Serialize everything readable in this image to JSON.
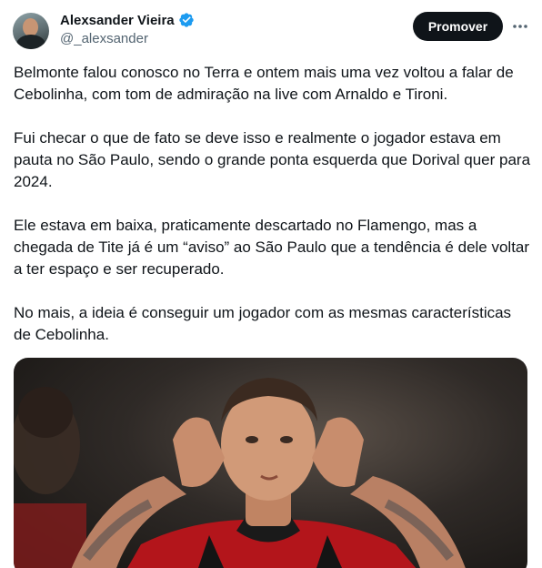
{
  "author": {
    "display_name": "Alexsander Vieira",
    "handle": "@_alexsander",
    "verified_icon": "verified-badge-icon",
    "verified_color": "#1d9bf0"
  },
  "actions": {
    "promote_label": "Promover",
    "more_icon": "more-options-icon"
  },
  "tweet": {
    "paragraphs": [
      "Belmonte falou conosco no Terra e ontem mais uma vez voltou a falar de Cebolinha, com tom de admiração na live com Arnaldo e Tironi.",
      "Fui checar o que de fato se deve isso e realmente o jogador estava em pauta no São Paulo, sendo o grande ponta esquerda que Dorival quer para 2024.",
      "Ele estava em baixa, praticamente descartado no Flamengo, mas a chegada de Tite já é um “aviso” ao São Paulo que a tendência é dele voltar a ter espaço e ser recuperado.",
      "No mais, a ideia é conseguir um jogador com as mesmas características de Cebolinha."
    ]
  },
  "colors": {
    "text": "#0f1419",
    "secondary": "#536471",
    "button_bg": "#0f1419"
  }
}
